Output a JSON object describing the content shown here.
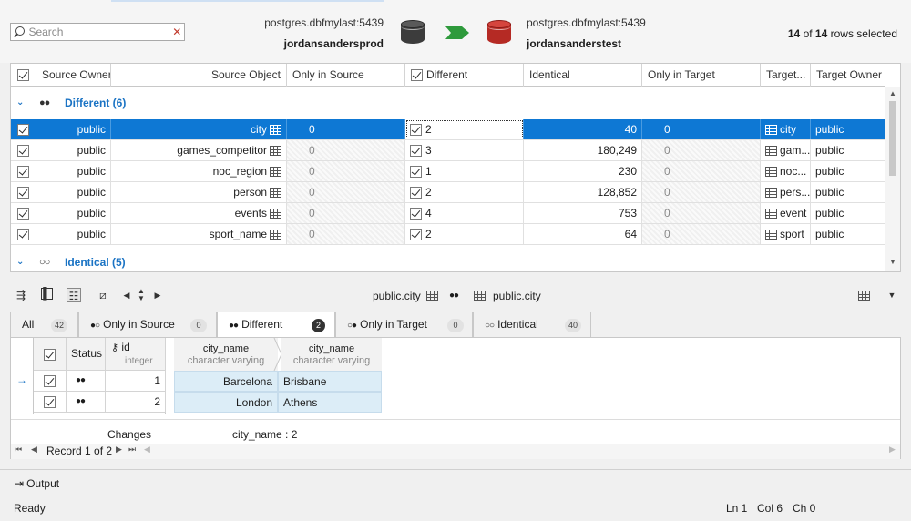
{
  "search": {
    "placeholder": "Search"
  },
  "source": {
    "server": "postgres.dbfmylast:5439",
    "database": "jordansandersprod",
    "color": "#3c3c3c"
  },
  "target": {
    "server": "postgres.dbfmylast:5439",
    "database": "jordansanderstest",
    "color": "#b52a24"
  },
  "selection": {
    "selected": "14",
    "of": "of",
    "total": "14",
    "suffix": "rows selected"
  },
  "columns": {
    "source_owner": "Source Owner",
    "source_object": "Source Object",
    "only_in_source": "Only in Source",
    "different": "Different",
    "identical": "Identical",
    "only_in_target": "Only in Target",
    "target_object": "Target...",
    "target_owner": "Target Owner"
  },
  "groups": {
    "different": "Different (6)",
    "identical": "Identical (5)"
  },
  "rows": [
    {
      "source_owner": "public",
      "source_object": "city",
      "only_in_source": "0",
      "different": "2",
      "identical": "40",
      "only_in_target": "0",
      "target_object": "city",
      "target_owner": "public"
    },
    {
      "source_owner": "public",
      "source_object": "games_competitor",
      "only_in_source": "0",
      "different": "3",
      "identical": "180,249",
      "only_in_target": "0",
      "target_object": "gam...",
      "target_owner": "public"
    },
    {
      "source_owner": "public",
      "source_object": "noc_region",
      "only_in_source": "0",
      "different": "1",
      "identical": "230",
      "only_in_target": "0",
      "target_object": "noc...",
      "target_owner": "public"
    },
    {
      "source_owner": "public",
      "source_object": "person",
      "only_in_source": "0",
      "different": "2",
      "identical": "128,852",
      "only_in_target": "0",
      "target_object": "pers...",
      "target_owner": "public"
    },
    {
      "source_owner": "public",
      "source_object": "events",
      "only_in_source": "0",
      "different": "4",
      "identical": "753",
      "only_in_target": "0",
      "target_object": "event",
      "target_owner": "public"
    },
    {
      "source_owner": "public",
      "source_object": "sport_name",
      "only_in_source": "0",
      "different": "2",
      "identical": "64",
      "only_in_target": "0",
      "target_object": "sport",
      "target_owner": "public"
    }
  ],
  "detail_toolbar": {
    "left_table": "public.city",
    "right_table": "public.city"
  },
  "tabs": [
    {
      "label": "All",
      "count": "42"
    },
    {
      "label": "Only in Source",
      "count": "0"
    },
    {
      "label": "Different",
      "count": "2"
    },
    {
      "label": "Only in Target",
      "count": "0"
    },
    {
      "label": "Identical",
      "count": "40"
    }
  ],
  "detail": {
    "status_header": "Status",
    "id_header": "id",
    "id_type": "integer",
    "col_name": "city_name",
    "col_type": "character varying",
    "records": [
      {
        "id": "1",
        "source": "Barcelona",
        "target": "Brisbane"
      },
      {
        "id": "2",
        "source": "London",
        "target": "Athens"
      }
    ],
    "changes_label": "Changes",
    "changes_value": "city_name : 2",
    "record_nav": "Record 1 of 2"
  },
  "output_label": "Output",
  "status": {
    "text": "Ready",
    "ln": "Ln 1",
    "col": "Col 6",
    "ch": "Ch 0"
  }
}
